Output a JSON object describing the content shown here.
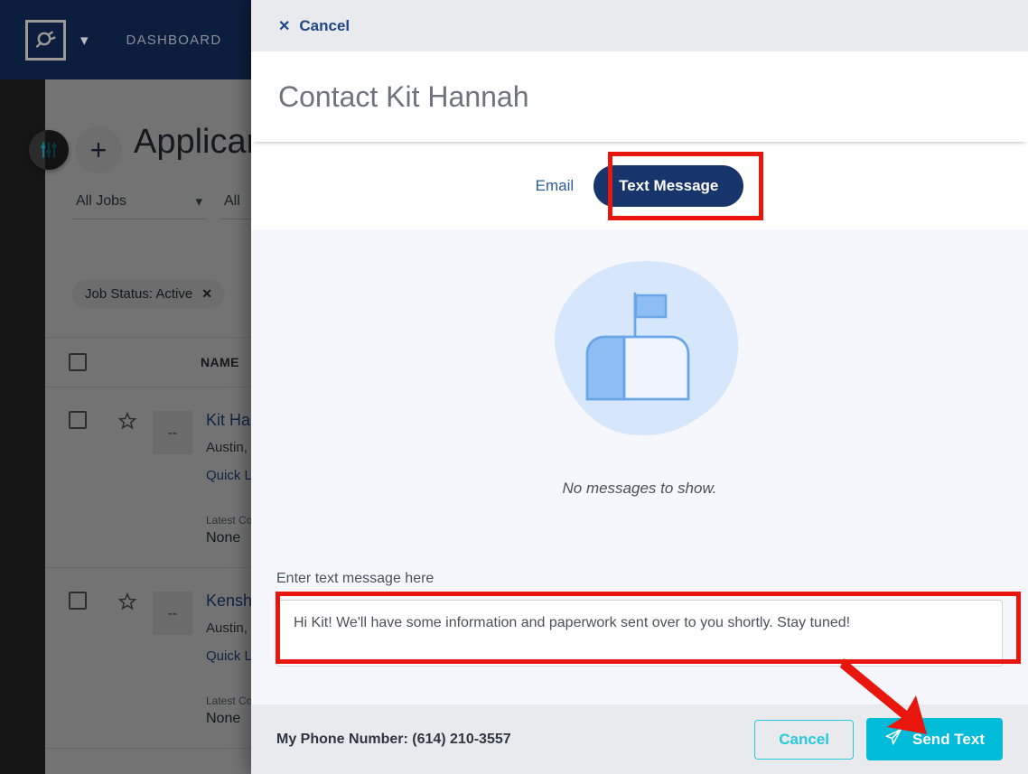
{
  "navbar": {
    "logo_icon": "plug-logo-icon",
    "chevron_icon": "chevron-down-icon",
    "dashboard_label": "DASHBOARD"
  },
  "page": {
    "title": "Applicants",
    "filter_icon": "sliders-filter-icon",
    "add_label": "+",
    "filters": [
      {
        "label": "All Jobs",
        "chevron": "chevron-down-icon"
      },
      {
        "label": "All",
        "chevron": "chevron-down-icon"
      }
    ],
    "chips": [
      {
        "label": "Job Status: Active",
        "remove_icon": "✕"
      }
    ],
    "table": {
      "columns": [
        "NAME"
      ],
      "rows": [
        {
          "avatar": "--",
          "name": "Kit Hannah",
          "location": "Austin, TX",
          "link": "Quick Look",
          "comm_label": "Latest Communication",
          "comm_value": "None"
        },
        {
          "avatar": "--",
          "name": "Kenshi Tanaka",
          "location": "Austin, TX",
          "link": "Quick Look",
          "comm_label": "Latest Communication",
          "comm_value": "None"
        }
      ]
    }
  },
  "modal": {
    "cancel_top_label": "Cancel",
    "cancel_top_icon": "close-x-icon",
    "title": "Contact Kit Hannah",
    "tabs": [
      {
        "label": "Email",
        "active": false
      },
      {
        "label": "Text Message",
        "active": true
      }
    ],
    "empty_state": {
      "illustration": "mailbox-illustration",
      "text": "No messages to show."
    },
    "compose": {
      "label": "Enter text message here",
      "value": "Hi Kit! We'll have some information and paperwork sent over to you shortly. Stay tuned!",
      "placeholder": ""
    },
    "footer": {
      "phone_label": "My Phone Number: (614) 210-3557",
      "cancel_label": "Cancel",
      "send_label": "Send Text",
      "send_icon": "paper-plane-icon"
    }
  },
  "annotations": {
    "highlight_color": "#e8160c",
    "boxes": [
      "text-message-tab",
      "message-textarea"
    ],
    "arrow_target": "send-text-button"
  },
  "colors": {
    "navy": "#0b1e3d",
    "tab_active": "#17356b",
    "cyan": "#00bcd8",
    "link_blue": "#24519b",
    "panel_bg": "#f5f7fc",
    "annotation_red": "#e8160c"
  }
}
